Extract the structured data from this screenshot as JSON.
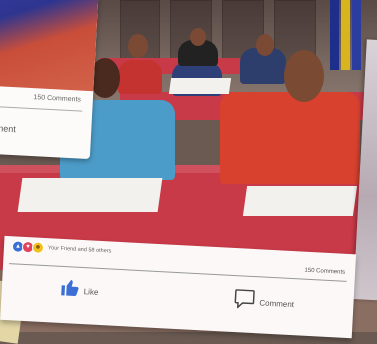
{
  "back_card": {
    "comments_count": "150 Comments",
    "comment_label": "mment"
  },
  "front_card": {
    "reactions_text": "Your Friend and 58 others",
    "comments_count": "150 Comments",
    "like_label": "Like",
    "comment_label": "Comment"
  },
  "colors": {
    "table_red": "#c93a48",
    "like_blue": "#3b6fd6",
    "card_bg": "#fbf8f7"
  }
}
